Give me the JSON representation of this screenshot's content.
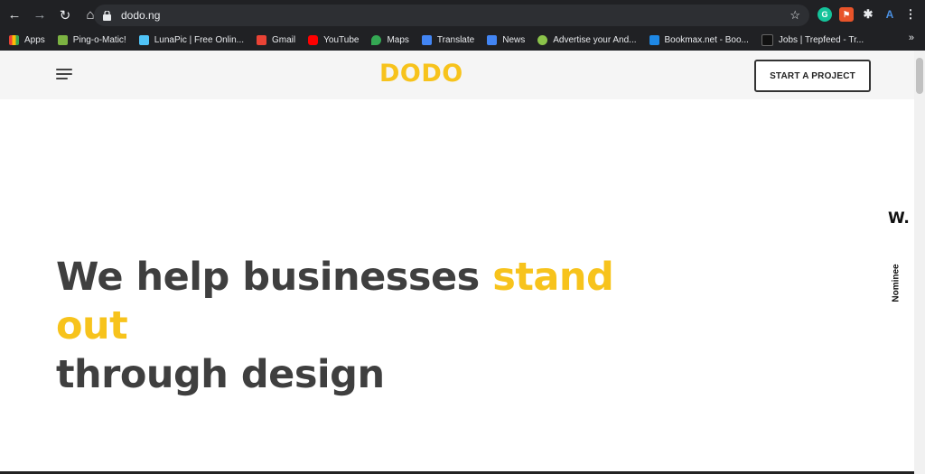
{
  "browser": {
    "url": "dodo.ng",
    "bookmarks": [
      {
        "label": "Apps",
        "color": "#ea4335"
      },
      {
        "label": "Ping-o-Matic!",
        "color": "#7cb342"
      },
      {
        "label": "LunaPic | Free Onlin...",
        "color": "#4fc3f7"
      },
      {
        "label": "Gmail",
        "color": "#ea4335"
      },
      {
        "label": "YouTube",
        "color": "#ff0000"
      },
      {
        "label": "Maps",
        "color": "#34a853"
      },
      {
        "label": "Translate",
        "color": "#4285f4"
      },
      {
        "label": "News",
        "color": "#4285f4"
      },
      {
        "label": "Advertise your And...",
        "color": "#8bc34a"
      },
      {
        "label": "Bookmax.net - Boo...",
        "color": "#1e88e5"
      },
      {
        "label": "Jobs | Trepfeed - Tr...",
        "color": "#111111"
      }
    ],
    "more": "»"
  },
  "site": {
    "logo": "DODO",
    "cta": "START A PROJECT",
    "hero_line1": "We help businesses ",
    "hero_accent": "stand out",
    "hero_line2": "through design",
    "badge": "W.",
    "nominee": "Nominee"
  },
  "colors": {
    "accent": "#f7c31c",
    "text": "#3f3f3f"
  }
}
